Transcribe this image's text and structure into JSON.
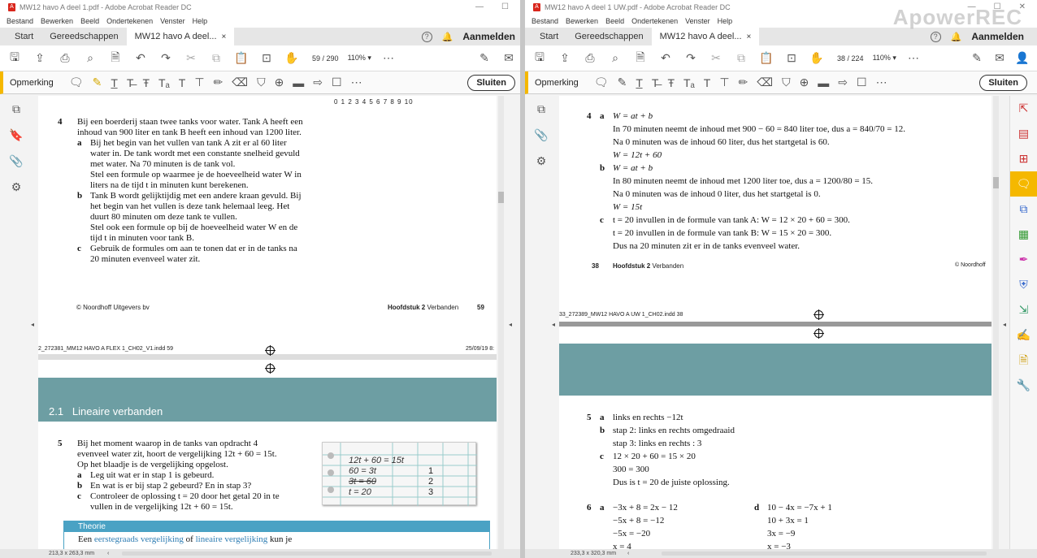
{
  "left": {
    "title": "MW12 havo A deel 1.pdf - Adobe Acrobat Reader DC",
    "menu": [
      "Bestand",
      "Bewerken",
      "Beeld",
      "Ondertekenen",
      "Venster",
      "Help"
    ],
    "tabs": [
      "Start",
      "Gereedschappen",
      "MW12 havo A deel..."
    ],
    "tab_close": "×",
    "signin": "Aanmelden",
    "page_current": "59",
    "page_total": "/ 290",
    "zoom": "110%",
    "comment_label": "Opmerking",
    "close_label": "Sluiten",
    "ruler": "0  1  2  3  4  5  6  7  8  9  10",
    "q4_num": "4",
    "q4_lines": [
      "Bij een boerderij staan twee tanks voor water. Tank A heeft een",
      "inhoud van 900 liter en tank B heeft een inhoud van 1200 liter."
    ],
    "q4a_letter": "a",
    "q4a_lines": [
      "Bij het begin van het vullen van tank A zit er al 60 liter",
      "water in. De tank wordt met een constante snelheid gevuld",
      "met water. Na 70 minuten is de tank vol.",
      "Stel een formule op waarmee je de hoeveelheid water W in",
      "liters na de tijd t in minuten kunt berekenen."
    ],
    "q4b_letter": "b",
    "q4b_lines": [
      "Tank B wordt gelijktijdig met een andere kraan gevuld. Bij",
      "het begin van het vullen is deze tank helemaal leeg. Het",
      "duurt 80 minuten om deze tank te vullen.",
      "Stel ook een formule op bij de hoeveelheid water W en de",
      "tijd t in minuten voor tank B."
    ],
    "q4c_letter": "c",
    "q4c_lines": [
      "Gebruik de formules om aan te tonen dat er in de tanks na",
      "20 minuten evenveel water zit."
    ],
    "footer_left": "© Noordhoff Uitgevers bv",
    "footer_chapter_bold": "Hoofdstuk 2",
    "footer_chapter": " Verbanden",
    "footer_page": "59",
    "slug_left": "2_272381_MM12 HAVO A FLEX 1_CH02_V1.indd  59",
    "slug_right": "25/09/19  8:",
    "section_num": "2.1",
    "section_title": "Lineaire verbanden",
    "q5_num": "5",
    "q5_lines": [
      "Bij het moment waarop in de tanks van opdracht 4",
      "evenveel water zit, hoort de vergelijking 12t + 60 = 15t.",
      "Op het blaadje is de vergelijking opgelost."
    ],
    "q5a_letter": "a",
    "q5a": "Leg uit wat er in stap 1 is gebeurd.",
    "q5b_letter": "b",
    "q5b": "En wat is er bij stap 2 gebeurd? En in stap 3?",
    "q5c_letter": "c",
    "q5c_lines": [
      "Controleer de oplossing t = 20 door het getal 20 in te",
      "vullen in de vergelijking 12t + 60 = 15t."
    ],
    "notebook_lines": [
      "12t + 60 = 15t",
      "60 = 3t",
      "3t = 60",
      "t = 20"
    ],
    "notebook_steps": [
      "1",
      "2",
      "3"
    ],
    "theory_header": "Theorie",
    "theory_pre": "Een ",
    "theory_term1": "eerstegraads vergelijking",
    "theory_mid": " of ",
    "theory_term2": "lineaire vergelijking",
    "theory_post": " kun je",
    "status_size": "213,3 x 263,3 mm"
  },
  "right": {
    "title": "MW12 havo A deel 1 UW.pdf - Adobe Acrobat Reader DC",
    "menu": [
      "Bestand",
      "Bewerken",
      "Beeld",
      "Ondertekenen",
      "Venster",
      "Help"
    ],
    "tabs": [
      "Start",
      "Gereedschappen",
      "MW12 havo A deel..."
    ],
    "tab_close": "×",
    "signin": "Aanmelden",
    "page_current": "38",
    "page_total": "/ 224",
    "zoom": "110%",
    "comment_label": "Opmerking",
    "close_label": "Sluiten",
    "watermark": "ApowerREC",
    "a4_num": "4",
    "a4_letters": [
      "a",
      "b",
      "c"
    ],
    "a4a_lines": [
      "W = at + b",
      "In 70 minuten neemt de inhoud met 900 − 60 = 840 liter toe, dus a = 840/70 = 12.",
      "Na 0 minuten was de inhoud 60 liter, dus het startgetal is 60.",
      "W = 12t + 60"
    ],
    "a4b_lines": [
      "W = at + b",
      "In 80 minuten neemt de inhoud met 1200 liter toe, dus a = 1200/80 = 15.",
      "Na 0 minuten was de inhoud 0 liter, dus het startgetal is 0.",
      "W = 15t"
    ],
    "a4c_lines": [
      "t = 20 invullen in de formule van tank A: W = 12 × 20 + 60 = 300.",
      "t = 20 invullen in de formule van tank B: W = 15 × 20 = 300.",
      "Dus na 20 minuten zit er in de tanks evenveel water."
    ],
    "footer_page": "38",
    "footer_chapter_bold": "Hoofdstuk 2",
    "footer_chapter": " Verbanden",
    "footer_right": "© Noordhoff",
    "slug_left": "33_272389_MW12 HAVO A UW 1_CH02.indd  38",
    "a5_num": "5",
    "a5_letters": [
      "a",
      "b",
      "c"
    ],
    "a5a": "links en rechts −12t",
    "a5b_lines": [
      "stap 2: links en rechts omgedraaid",
      "stap 3: links en rechts : 3"
    ],
    "a5c_lines": [
      "12 × 20 + 60 = 15 × 20",
      "300 = 300",
      "Dus is t = 20 de juiste oplossing."
    ],
    "a6_num": "6",
    "a6a_letter": "a",
    "a6a_lines": [
      "−3x + 8 = 2x − 12",
      "−5x + 8 = −12",
      "−5x = −20",
      "x = 4"
    ],
    "a6d_letter": "d",
    "a6d_lines": [
      "10 − 4x = −7x + 1",
      "10 + 3x = 1",
      "3x = −9",
      "x = −3"
    ],
    "status_size": "233,3 x 320,3 mm"
  }
}
